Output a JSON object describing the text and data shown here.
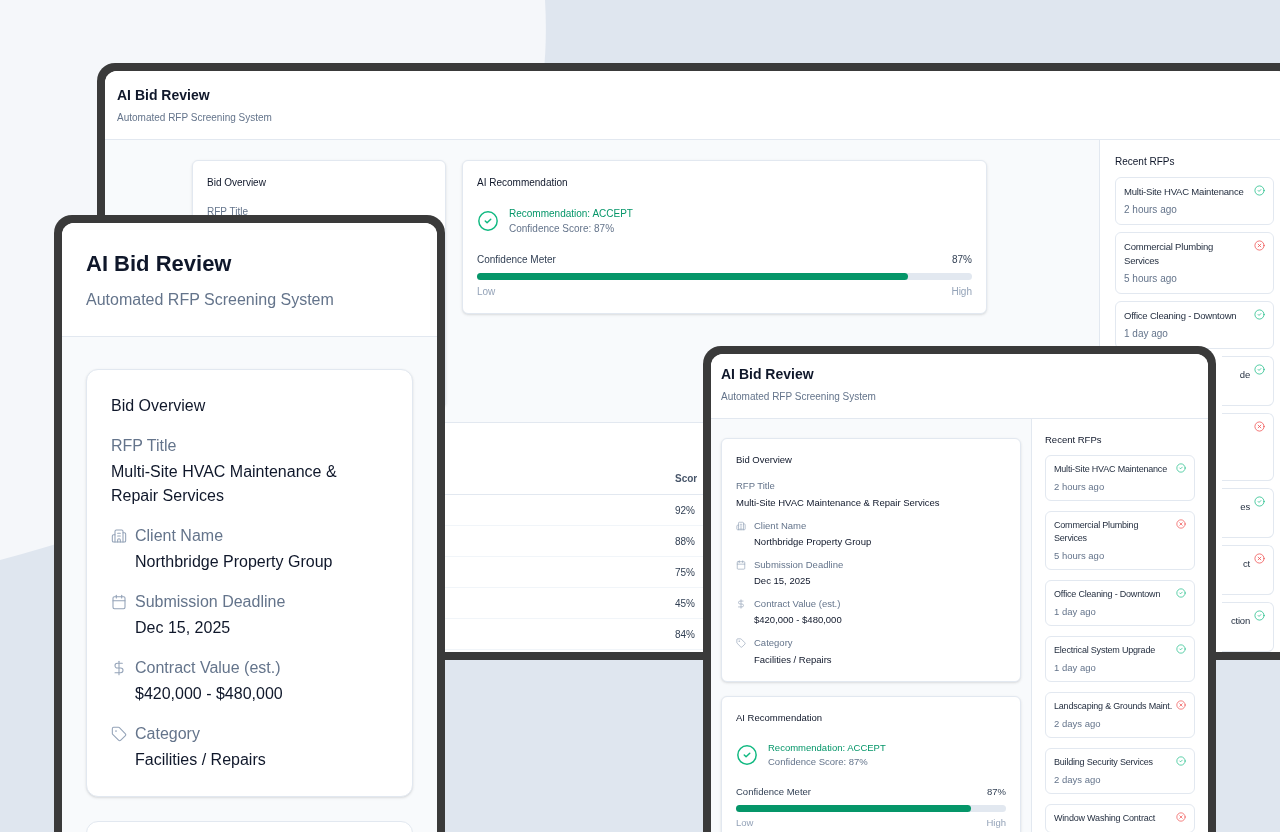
{
  "desktop": {
    "header": {
      "title": "AI Bid Review",
      "subtitle": "Automated RFP Screening System"
    },
    "bid_overview": {
      "title": "Bid Overview",
      "fields": [
        {
          "label": "RFP Title"
        }
      ]
    },
    "ai_recommendation": {
      "title": "AI Recommendation",
      "accepted": true,
      "recommendation": "Recommendation: ACCEPT",
      "confidence": "Confidence Score: 87%",
      "meter": {
        "label": "Confidence Meter",
        "reading": "87%",
        "level": 0.87,
        "low": "Low",
        "high": "High"
      }
    },
    "table": {
      "columns": [
        "Scor"
      ],
      "rows": [
        [
          "92%"
        ],
        [
          "88%"
        ],
        [
          "75%"
        ],
        [
          "45%"
        ],
        [
          "84%"
        ]
      ]
    },
    "sidebar": {
      "title": "Recent RFPs",
      "items": [
        {
          "kind": "full",
          "title": "Multi-Site HVAC Maintenance",
          "time": "2 hours ago",
          "accepted": true
        },
        {
          "kind": "full",
          "title": "Commercial Plumbing Services",
          "time": "5 hours ago",
          "accepted": false
        },
        {
          "kind": "full",
          "title": "Office Cleaning - Downtown",
          "time": "1 day ago",
          "accepted": true
        },
        {
          "kind": "clipped",
          "title": "de",
          "accepted": true
        },
        {
          "kind": "clipped",
          "accepted": false
        },
        {
          "kind": "clipped",
          "title": "es",
          "accepted": true
        },
        {
          "kind": "clipped",
          "title": "ct",
          "accepted": false
        },
        {
          "kind": "clipped",
          "title": "ction",
          "accepted": true
        }
      ]
    }
  },
  "phone": {
    "header": {
      "title": "AI Bid Review",
      "subtitle": "Automated RFP Screening System"
    },
    "bid_overview": {
      "title": "Bid Overview",
      "fields": [
        {
          "label": "RFP Title",
          "value": "Multi-Site HVAC Maintenance & Repair Services"
        },
        {
          "label": "Client Name",
          "value": "Northbridge Property Group"
        },
        {
          "label": "Submission Deadline",
          "value": "Dec 15, 2025"
        },
        {
          "label": "Contract Value (est.)",
          "value": "$420,000 - $480,000"
        },
        {
          "label": "Category",
          "value": "Facilities / Repairs"
        }
      ]
    }
  },
  "tablet": {
    "header": {
      "title": "AI Bid Review",
      "subtitle": "Automated RFP Screening System"
    },
    "bid_overview": {
      "title": "Bid Overview",
      "fields": [
        {
          "label": "RFP Title",
          "value": "Multi-Site HVAC Maintenance & Repair Services"
        },
        {
          "label": "Client Name",
          "value": "Northbridge Property Group"
        },
        {
          "label": "Submission Deadline",
          "value": "Dec 15, 2025"
        },
        {
          "label": "Contract Value (est.)",
          "value": "$420,000 - $480,000"
        },
        {
          "label": "Category",
          "value": "Facilities / Repairs"
        }
      ]
    },
    "ai_recommendation": {
      "title": "AI Recommendation",
      "accepted": true,
      "recommendation": "Recommendation: ACCEPT",
      "confidence": "Confidence Score: 87%",
      "meter": {
        "label": "Confidence Meter",
        "reading": "87%",
        "level": 0.87,
        "low": "Low",
        "high": "High"
      }
    },
    "sidebar": {
      "title": "Recent RFPs",
      "items": [
        {
          "title": "Multi-Site HVAC Maintenance",
          "time": "2 hours ago",
          "accepted": true
        },
        {
          "title": "Commercial Plumbing Services",
          "time": "5 hours ago",
          "accepted": false
        },
        {
          "title": "Office Cleaning - Downtown",
          "time": "1 day ago",
          "accepted": true
        },
        {
          "title": "Electrical System Upgrade",
          "time": "1 day ago",
          "accepted": true
        },
        {
          "title": "Landscaping & Grounds Maint.",
          "time": "2 days ago",
          "accepted": false
        },
        {
          "title": "Building Security Services",
          "time": "2 days ago",
          "accepted": true
        },
        {
          "title": "Window Washing Contract",
          "accepted": false
        }
      ]
    }
  }
}
